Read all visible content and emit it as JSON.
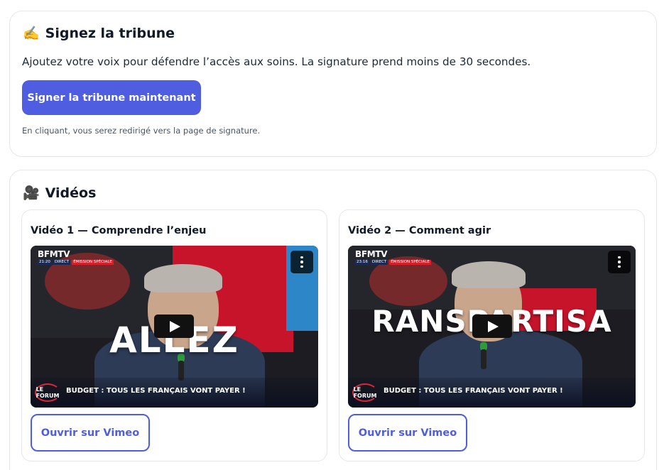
{
  "sign_section": {
    "icon": "writing-hand-icon",
    "icon_glyph": "✍️",
    "title": "Signez la tribune",
    "intro": "Ajoutez votre voix pour défendre l’accès aux soins. La signature prend moins de 30 secondes.",
    "button_label": "Signer la tribune maintenant",
    "note": "En cliquant, vous serez redirigé vers la page de signature.",
    "accent_color": "#4f5ee0"
  },
  "videos_section": {
    "icon": "movie-camera-icon",
    "icon_glyph": "🎥",
    "title": "Vidéos",
    "videos": [
      {
        "title": "Vidéo 1 — Comprendre l’enjeu",
        "channel": "BFMTV",
        "time": "21:20",
        "live_tag": "DIRECT",
        "special_tag": "ÉMISSION SPÉCIALE",
        "overlay_text": "ALLEZ",
        "show_logo": "LE FORUM",
        "headline": "BUDGET : TOUS LES FRANÇAIS VONT PAYER !",
        "button_label": "Ouvrir sur Vimeo"
      },
      {
        "title": "Vidéo 2 — Comment agir",
        "channel": "BFMTV",
        "time": "23:16",
        "live_tag": "DIRECT",
        "special_tag": "ÉMISSION SPÉCIALE",
        "overlay_text": "RANSPARTISA",
        "show_logo": "LE FORUM",
        "headline": "BUDGET : TOUS LES FRANÇAIS VONT PAYER !",
        "button_label": "Ouvrir sur Vimeo"
      }
    ]
  }
}
